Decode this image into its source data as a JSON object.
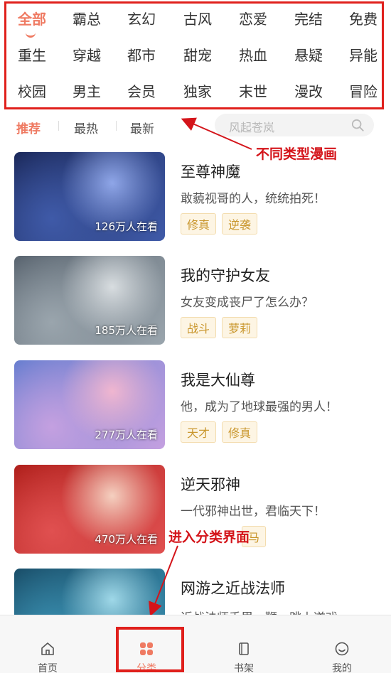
{
  "categories": [
    [
      "全部",
      "霸总",
      "玄幻",
      "古风",
      "恋爱",
      "完结",
      "免费"
    ],
    [
      "重生",
      "穿越",
      "都市",
      "甜宠",
      "热血",
      "悬疑",
      "异能"
    ],
    [
      "校园",
      "男主",
      "会员",
      "独家",
      "末世",
      "漫改",
      "冒险"
    ]
  ],
  "sort_tabs": [
    "推荐",
    "最热",
    "最新"
  ],
  "search": {
    "placeholder": "风起苍岚"
  },
  "annotations": {
    "types": "不同类型漫画",
    "enter": "进入分类界面"
  },
  "comics": [
    {
      "title": "至尊神魔",
      "desc": "敢藐视哥的人，统统拍死！",
      "views": "126万人在看",
      "tags": [
        "修真",
        "逆袭"
      ],
      "palette": [
        "#1c2a5c",
        "#3f5aa8",
        "#8fa6e8"
      ]
    },
    {
      "title": "我的守护女友",
      "desc": " 女友变成丧尸了怎么办？",
      "views": "185万人在看",
      "tags": [
        "战斗",
        "萝莉"
      ],
      "palette": [
        "#5a6570",
        "#9aa5ad",
        "#d8dde0"
      ]
    },
    {
      "title": "我是大仙尊",
      "desc": "他，成为了地球最强的男人！",
      "views": "277万人在看",
      "tags": [
        "天才",
        "修真"
      ],
      "palette": [
        "#6a7fd0",
        "#c4a0e0",
        "#f0b6d0"
      ]
    },
    {
      "title": "逆天邪神",
      "desc": "一代邪神出世，君临天下！",
      "views": "470万人在看",
      "tags": [
        "马"
      ],
      "palette": [
        "#b0201c",
        "#e05050",
        "#f5d0c0"
      ]
    },
    {
      "title": "网游之近战法师",
      "desc": "近战法师手里一鞭，跳上遂戏",
      "views": "",
      "tags": [],
      "palette": [
        "#1a4f6a",
        "#3a8fb0",
        "#9fd8e8"
      ]
    }
  ],
  "bottom_nav": [
    "首页",
    "分类",
    "书架",
    "我的"
  ],
  "colors": {
    "accent": "#ef7a62",
    "annotation": "#e0201c",
    "tag_text": "#c9962c"
  }
}
